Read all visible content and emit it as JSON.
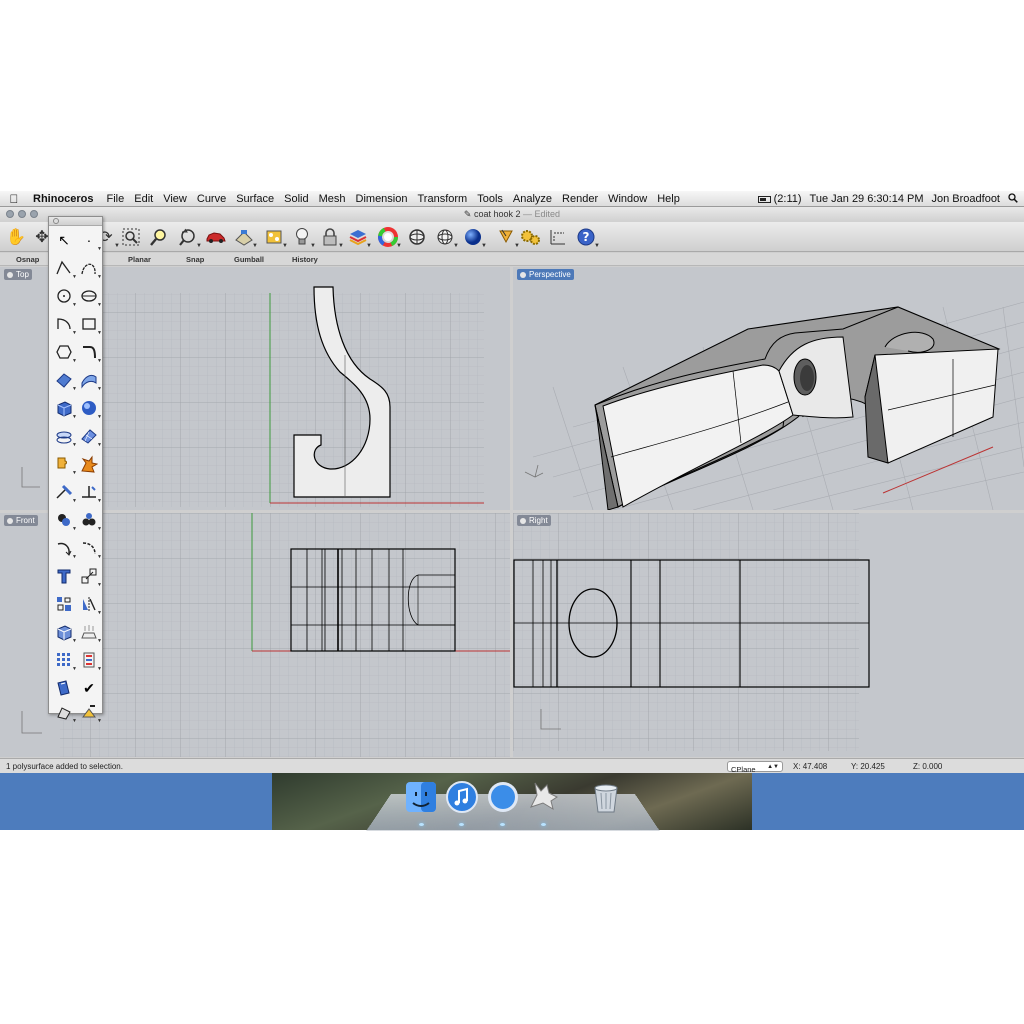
{
  "menubar": {
    "app": "Rhinoceros",
    "items": [
      "File",
      "Edit",
      "View",
      "Curve",
      "Surface",
      "Solid",
      "Mesh",
      "Dimension",
      "Transform",
      "Tools",
      "Analyze",
      "Render",
      "Window",
      "Help"
    ],
    "battery": "(2:11)",
    "clock": "Tue Jan 29  6:30:14 PM",
    "user": "Jon Broadfoot"
  },
  "window": {
    "title": "coat hook 2",
    "title_suffix": "— Edited"
  },
  "toolbar_labels": [
    "Osnap",
    "Planar",
    "Snap",
    "Gumball",
    "History"
  ],
  "viewports": {
    "top": "Top",
    "perspective": "Perspective",
    "front": "Front",
    "right": "Right"
  },
  "status": {
    "message": "1 polysurface added to selection.",
    "cplane": "CPlane",
    "x": "X: 47.408",
    "y": "Y: 20.425",
    "z": "Z: 0.000"
  },
  "icons": {
    "toolbar": [
      "pan-hand-icon",
      "move-icon",
      "rotate-view-icon",
      "zoom-window-icon",
      "zoom-extents-icon",
      "undo-view-icon",
      "car-render-icon",
      "named-view-icon",
      "texture-map-icon",
      "light-bulb-icon",
      "lock-icon",
      "layers-icon",
      "color-wheel-icon",
      "material-icon",
      "ghosted-sphere-icon",
      "wireframe-sphere-icon",
      "shaded-sphere-icon",
      "select-filter-icon",
      "settings-gears-icon",
      "dimension-icon",
      "help-icon"
    ],
    "dock": [
      "finder-icon",
      "itunes-icon",
      "safari-icon",
      "rhino-icon",
      "trash-icon"
    ]
  },
  "colors": {
    "accent": "#4d79b8",
    "viewport_bg": "#c4c7cc",
    "desktop": "#4d7cbd"
  }
}
